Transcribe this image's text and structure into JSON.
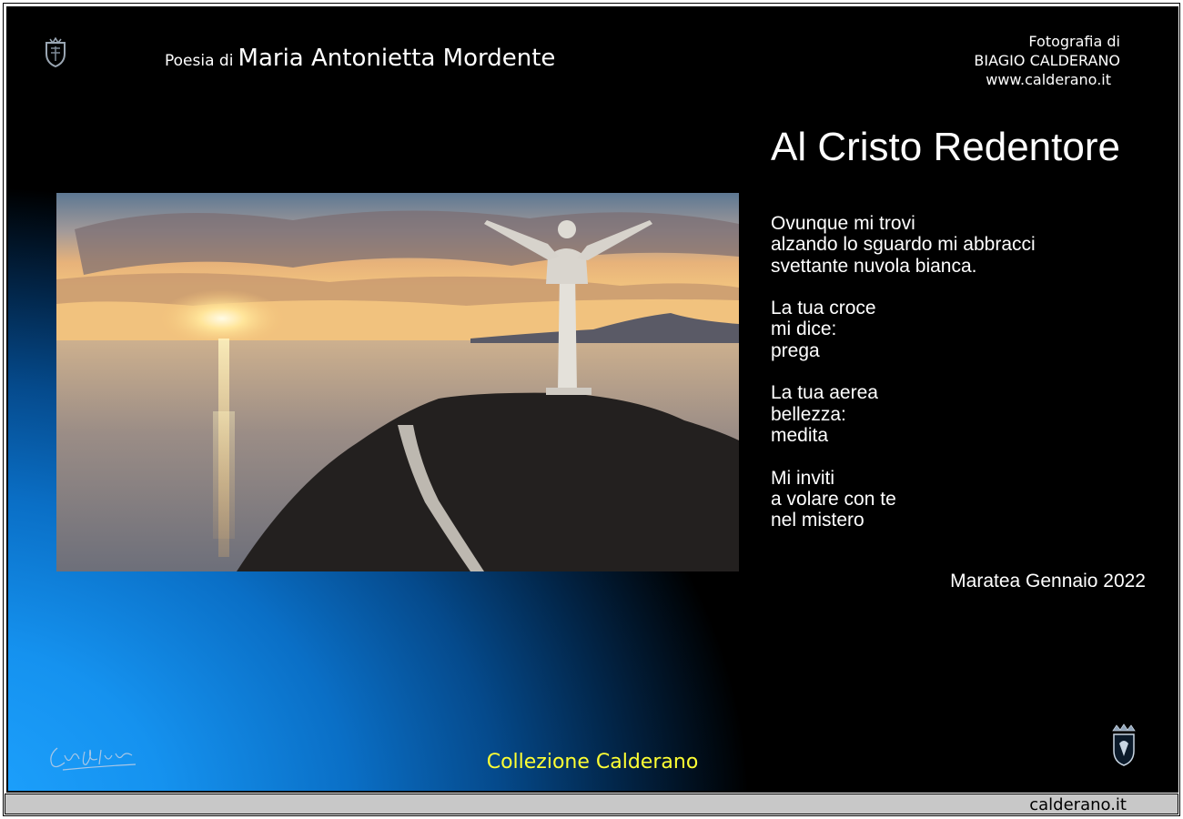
{
  "header": {
    "poesia_prefix": "Poesia di",
    "author": "Maria Antonietta Mordente",
    "credit_line1": "Fotografia di",
    "credit_line2": "BIAGIO CALDERANO",
    "credit_site": "www.calderano.it"
  },
  "poem": {
    "title": "Al Cristo Redentore",
    "stanzas": [
      [
        "Ovunque mi trovi",
        "alzando lo sguardo mi abbracci",
        "svettante nuvola bianca."
      ],
      [
        "La tua croce",
        "mi dice:",
        "prega"
      ],
      [
        "La tua aerea",
        "bellezza:",
        "medita"
      ],
      [
        "Mi inviti",
        "a volare con te",
        "nel mistero"
      ]
    ],
    "place_date": "Maratea Gennaio 2022"
  },
  "footer": {
    "collection": "Collezione Calderano",
    "site_link": "calderano.it"
  },
  "icons": {
    "top_left": "crest-icon",
    "bottom_left": "signature-icon",
    "bottom_right": "coat-of-arms-icon"
  },
  "colors": {
    "collection_text": "#ffff33",
    "footer_bar": "#c8c8c8"
  }
}
